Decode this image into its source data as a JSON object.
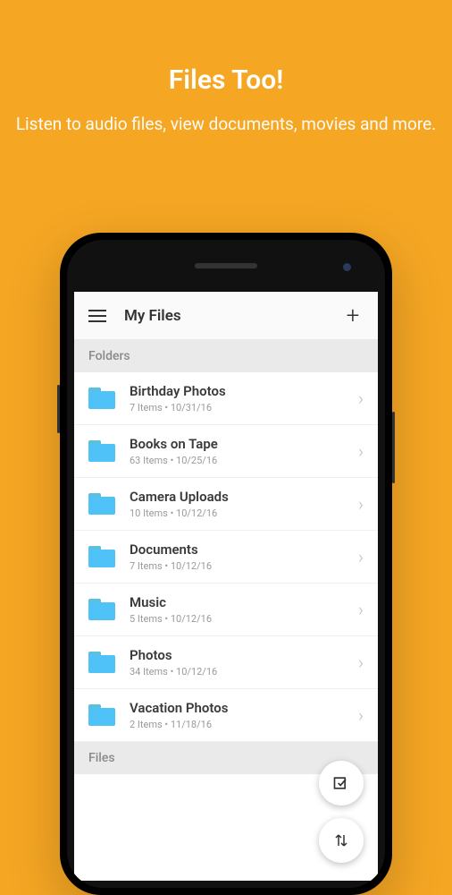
{
  "promo": {
    "title": "Files Too!",
    "subtitle": "Listen to audio files, view documents, movies and more."
  },
  "appbar": {
    "title": "My Files"
  },
  "sections": {
    "folders_label": "Folders",
    "files_label": "Files"
  },
  "folders": [
    {
      "name": "Birthday Photos",
      "meta": "7 Items • 10/31/16"
    },
    {
      "name": "Books on Tape",
      "meta": "63 Items • 10/25/16"
    },
    {
      "name": "Camera Uploads",
      "meta": "10 Items • 10/12/16"
    },
    {
      "name": "Documents",
      "meta": "7 Items • 10/12/16"
    },
    {
      "name": "Music",
      "meta": "5 Items • 10/12/16"
    },
    {
      "name": "Photos",
      "meta": "34 Items • 10/12/16"
    },
    {
      "name": "Vacation Photos",
      "meta": "2 Items • 11/18/16"
    }
  ],
  "icons": {
    "select": "☑",
    "sort": "⇅"
  }
}
